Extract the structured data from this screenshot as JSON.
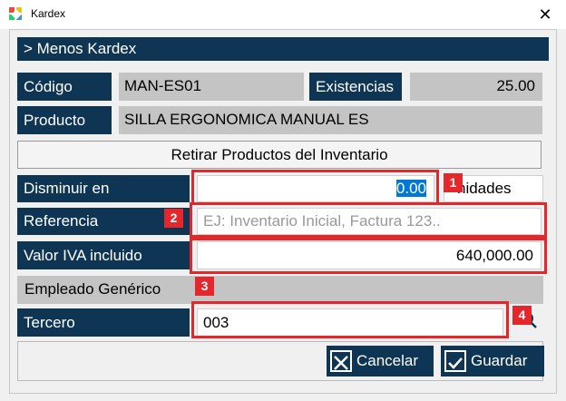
{
  "window": {
    "title": "Kardex",
    "close_glyph": "✕"
  },
  "header": {
    "label": "> Menos Kardex"
  },
  "codigo": {
    "label": "Código",
    "value": "MAN-ES01"
  },
  "existencias": {
    "label": "Existencias",
    "value": "25.00"
  },
  "producto": {
    "label": "Producto",
    "value": "SILLA ERGONOMICA MANUAL ES"
  },
  "section": {
    "title": "Retirar Productos del Inventario"
  },
  "disminuir": {
    "label": "Disminuir en",
    "value": "0.00",
    "unit": "Unidades",
    "unit_visible": "nidades"
  },
  "referencia": {
    "label": "Referencia",
    "value": "",
    "placeholder": "EJ: Inventario Inicial, Factura 123.."
  },
  "valor_iva": {
    "label": "Valor IVA incluido",
    "value": "640,000.00"
  },
  "empleado": {
    "label": "Empleado Genérico"
  },
  "tercero": {
    "label": "Tercero",
    "value": "003"
  },
  "annotations": [
    "1",
    "2",
    "3",
    "4"
  ],
  "buttons": {
    "cancel": "Cancelar",
    "save": "Guardar"
  },
  "colors": {
    "navy": "#0f3554",
    "annotation_red": "#e5262b",
    "selection_blue": "#0078d7"
  },
  "icons": {
    "app": "app-logo-icon",
    "close": "close-icon",
    "search": "search-icon",
    "cancel": "x-box-icon",
    "save": "check-box-icon"
  }
}
